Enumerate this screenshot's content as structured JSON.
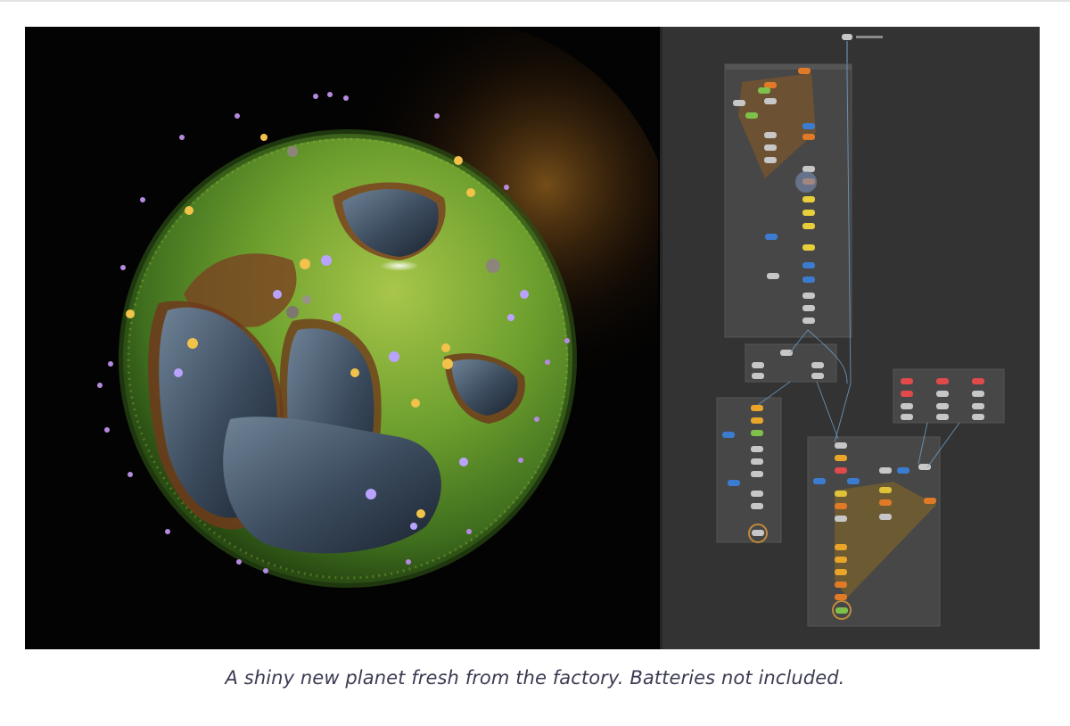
{
  "figure": {
    "left_image": "planet-render",
    "right_image": "node-graph",
    "colors": {
      "background": "#000000",
      "grass": "#5e9a2c",
      "water": "#3b4a5c",
      "soil": "#8a4a22",
      "flower_violet": "#b9a3ff",
      "flower_yellow": "#f2c24a",
      "graph_bg": "#333333",
      "node_frame": "#4a4a4a"
    }
  },
  "caption": "A shiny new planet fresh from the factory. Batteries not included."
}
